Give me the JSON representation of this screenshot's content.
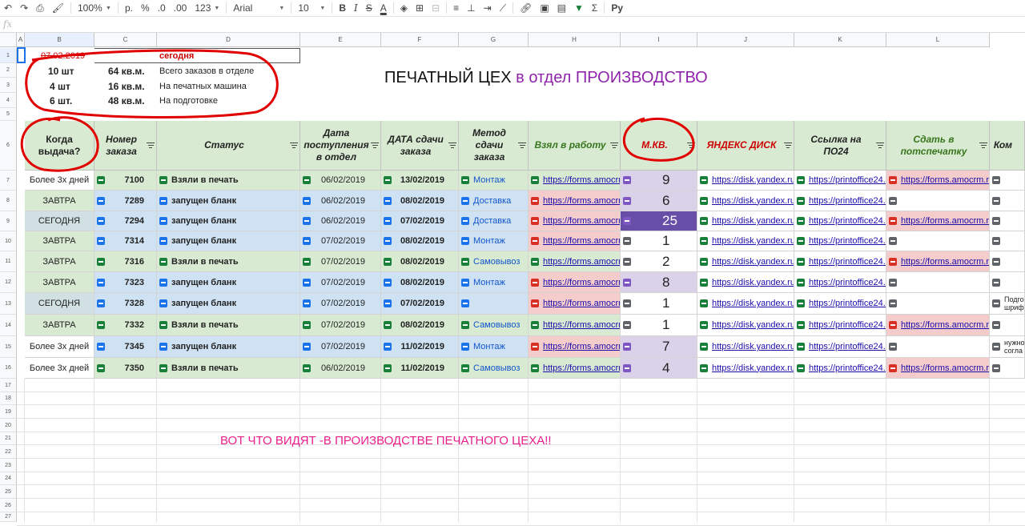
{
  "toolbar": {
    "zoom": "100%",
    "currency": "р.",
    "percent": "%",
    "dec_less": ".0",
    "dec_more": ".00",
    "format_more": "123",
    "font": "Arial",
    "font_size": "10",
    "bold": "B",
    "italic": "I",
    "strike": "S",
    "text_color": "A",
    "input_tools": "Ру",
    "sigma": "Σ"
  },
  "formula_bar": {
    "fx": "fx"
  },
  "columns": [
    "A",
    "B",
    "C",
    "D",
    "E",
    "F",
    "G",
    "H",
    "I",
    "J",
    "K",
    "L"
  ],
  "rows": [
    "1",
    "2",
    "3",
    "4",
    "5",
    "6",
    "7",
    "8",
    "9",
    "10",
    "11",
    "12",
    "13",
    "14",
    "15",
    "16",
    "17",
    "18",
    "19",
    "20",
    "21",
    "22",
    "23",
    "24",
    "25",
    "26",
    "27"
  ],
  "summary": {
    "r1_date": "07.02.2019",
    "r1_label": "сегодня",
    "r2_count": "10 шт",
    "r2_area": "64 кв.м.",
    "r2_label": "Всего заказов в отделе",
    "r3_count": "4 шт",
    "r3_area": "16 кв.м.",
    "r3_label": "На печатных машина",
    "r4_count": "6 шт.",
    "r4_area": "48 кв.м.",
    "r4_label": "На подготовке"
  },
  "title": {
    "part1": "ПЕЧАТНЫЙ ЦЕХ ",
    "part2": "в отдел ПРОИЗВОДСТВО"
  },
  "headers": {
    "b": "Когда выдача?",
    "c": "Номер заказа",
    "d": "Статус",
    "e": "Дата поступления в отдел",
    "f": "ДАТА сдачи заказа",
    "g": "Метод сдачи заказа",
    "h": "Взял в работу",
    "i": "М.КВ.",
    "j": "ЯНДЕКС ДИСК",
    "k": "Ссылка на ПО24",
    "l": "Сдать в потспечатку",
    "m": "Ком"
  },
  "orders": [
    {
      "when": "Более 3х дней",
      "num": "7100",
      "status": "Взяли в печать",
      "in": "06/02/2019",
      "due": "13/02/2019",
      "method": "Монтаж",
      "h": "https://forms.amocrm",
      "m2": "9",
      "j": "https://disk.yandex.ru/c",
      "k": "https://printoffice24.co",
      "l": "https://forms.amocrm.ru/c",
      "comment": ""
    },
    {
      "when": "ЗАВТРА",
      "num": "7289",
      "status": "запущен бланк",
      "in": "06/02/2019",
      "due": "08/02/2019",
      "method": "Доставка",
      "h": "https://forms.amocrm",
      "m2": "6",
      "j": "https://disk.yandex.ru/c",
      "k": "https://printoffice24.co",
      "l": "",
      "comment": ""
    },
    {
      "when": "СЕГОДНЯ",
      "num": "7294",
      "status": "запущен бланк",
      "in": "06/02/2019",
      "due": "07/02/2019",
      "method": "Доставка",
      "h": "https://forms.amocrm",
      "m2": "25",
      "j": "https://disk.yandex.ru/c",
      "k": "https://printoffice24.co",
      "l": "https://forms.amocrm.ru/c",
      "comment": ""
    },
    {
      "when": "ЗАВТРА",
      "num": "7314",
      "status": "запущен бланк",
      "in": "07/02/2019",
      "due": "08/02/2019",
      "method": "Монтаж",
      "h": "https://forms.amocrm",
      "m2": "1",
      "j": "https://disk.yandex.ru/c",
      "k": "https://printoffice24.co",
      "l": "",
      "comment": ""
    },
    {
      "when": "ЗАВТРА",
      "num": "7316",
      "status": "Взяли в печать",
      "in": "07/02/2019",
      "due": "08/02/2019",
      "method": "Самовывоз",
      "h": "https://forms.amocrm",
      "m2": "2",
      "j": "https://disk.yandex.ru/c",
      "k": "https://printoffice24.co",
      "l": "https://forms.amocrm.ru/c",
      "comment": ""
    },
    {
      "when": "ЗАВТРА",
      "num": "7323",
      "status": "запущен бланк",
      "in": "07/02/2019",
      "due": "08/02/2019",
      "method": "Монтаж",
      "h": "https://forms.amocrm",
      "m2": "8",
      "j": "https://disk.yandex.ru/c",
      "k": "https://printoffice24.co",
      "l": "",
      "comment": ""
    },
    {
      "when": "СЕГОДНЯ",
      "num": "7328",
      "status": "запущен бланк",
      "in": "07/02/2019",
      "due": "07/02/2019",
      "method": "",
      "h": "https://forms.amocrm",
      "m2": "1",
      "j": "https://disk.yandex.ru/c",
      "k": "https://printoffice24.co",
      "l": "",
      "comment": "Подго шриф"
    },
    {
      "when": "ЗАВТРА",
      "num": "7332",
      "status": "Взяли в печать",
      "in": "07/02/2019",
      "due": "08/02/2019",
      "method": "Самовывоз",
      "h": "https://forms.amocrm",
      "m2": "1",
      "j": "https://disk.yandex.ru/c",
      "k": "https://printoffice24.co",
      "l": "https://forms.amocrm.ru/c",
      "comment": ""
    },
    {
      "when": "Более 3х дней",
      "num": "7345",
      "status": "запущен бланк",
      "in": "07/02/2019",
      "due": "11/02/2019",
      "method": "Монтаж",
      "h": "https://forms.amocrm",
      "m2": "7",
      "j": "https://disk.yandex.ru/c",
      "k": "https://printoffice24.co",
      "l": "",
      "comment": "нужно согла"
    },
    {
      "when": "Более 3х дней",
      "num": "7350",
      "status": "Взяли в печать",
      "in": "06/02/2019",
      "due": "11/02/2019",
      "method": "Самовывоз",
      "h": "https://forms.amocrm",
      "m2": "4",
      "j": "https://disk.yandex.ru/c",
      "k": "https://printoffice24.co",
      "l": "https://forms.amocrm.ru/c",
      "comment": ""
    }
  ],
  "annotation_text": "ВОТ ЧТО ВИДЯТ -В ПРОИЗВОДСТВЕ ПЕЧАТНОГО ЦЕХА!!",
  "colors": {
    "header_bg": "#d9ead3",
    "green_row": "#d9ead3",
    "blue_row": "#cfe2f3",
    "teal_row": "#d0e0e3",
    "red_link": "#f4cccc",
    "purple_cell": "#d9d2e9",
    "purple_strong": "#674ea7",
    "annotation_red": "#e00000",
    "annotation_pink": "#e91e8c"
  }
}
